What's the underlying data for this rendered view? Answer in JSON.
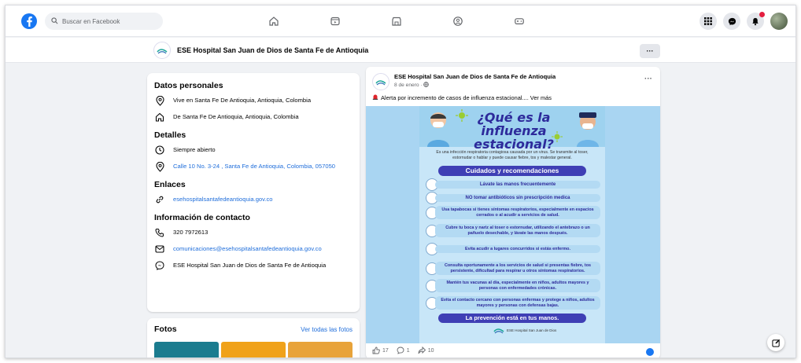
{
  "topbar": {
    "search_placeholder": "Buscar en Facebook",
    "nav": [
      "home-icon",
      "video-icon",
      "marketplace-icon",
      "groups-icon",
      "gaming-icon"
    ],
    "right": [
      "menu-grid-icon",
      "messenger-icon",
      "bell-icon",
      "profile-avatar"
    ]
  },
  "page": {
    "name": "ESE Hospital San Juan de Dios de Santa Fe de Antioquia",
    "more_label": "···"
  },
  "info": {
    "personal_title": "Datos personales",
    "lives_in": "Vive en Santa Fe De Antioquia, Antioquia, Colombia",
    "from": "De Santa Fe De Antioquia, Antioquia, Colombia",
    "details_title": "Detalles",
    "hours": "Siempre abierto",
    "address": "Calle 10 No. 3-24 , Santa Fe de Antioquia, Colombia, 057050",
    "links_title": "Enlaces",
    "website": "esehospitalsantafedeantioquia.gov.co",
    "contact_title": "Información de contacto",
    "phone": "320 7972613",
    "email": "comunicaciones@esehospitalsantafedeantioquia.gov.co",
    "messenger": "ESE Hospital San Juan de Dios de Santa Fe de Antioquia"
  },
  "photos": {
    "title": "Fotos",
    "see_all": "Ver todas las fotos"
  },
  "post": {
    "author": "ESE Hospital San Juan de Dios de Santa Fe de Antioquia",
    "date": "8 de enero · ",
    "more": "···",
    "text": "Alerta por incremento de casos de influenza estacional.... Ver más",
    "poster": {
      "title": "¿Qué es la influenza estacional?",
      "intro": "Es una infección respiratoria contagiosa causada por un virus. Se transmite al toser, estornudar o hablar y puede causar fiebre, tos y malestar general.",
      "header": "Cuidados y recomendaciones",
      "items": [
        "Lávate las manos frecuentemente",
        "NO tomar antibióticos sin prescripción medica",
        "Usa tapabocas si tienes síntomas respiratorios, especialmente en espacios cerrados o al acudir a servicios de salud.",
        "Cubre tu boca y nariz al toser o estornudar, utilizando el antebrazo o un pañuelo desechable, y lávate las manos después.",
        "Evita acudir a lugares concurridos si estás enfermo.",
        "Consulta oportunamente a los servicios de salud si presentas fiebre, tos persistente, dificultad para respirar u otros síntomas respiratorios.",
        "Mantén tus vacunas al día, especialmente en niños, adultos mayores y personas con enfermedades crónicas.",
        "Evita el contacto cercano con personas enfermas y protege a niños, adultos mayores y personas con defensas bajas."
      ],
      "footer": "La prevención está en tus manos.",
      "logo_text": "ESE Hospital San Juan de Dios"
    },
    "likes": "17",
    "comments": "1",
    "shares": "10"
  },
  "colors": {
    "brand": "#1877f2",
    "link": "#216fdb",
    "poster_accent": "#3f3fb5"
  }
}
